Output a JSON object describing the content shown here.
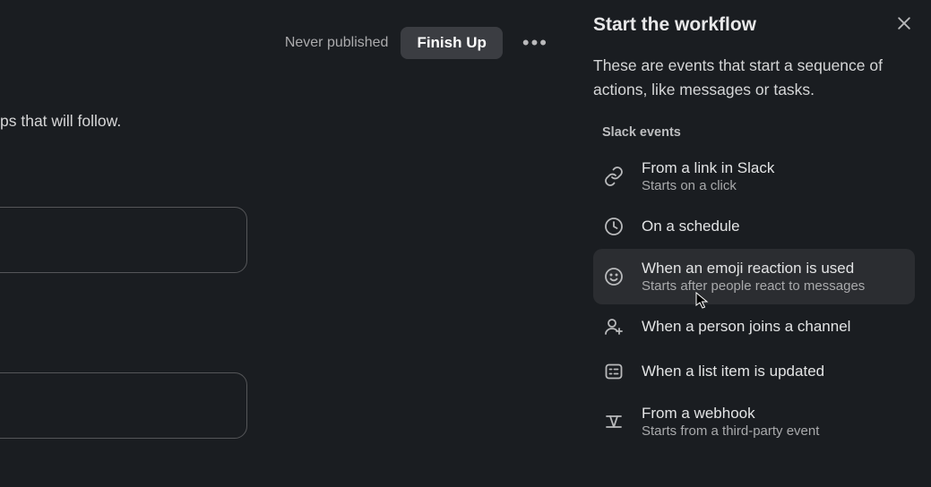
{
  "main": {
    "status": "Never published",
    "finish_label": "Finish Up",
    "body_fragment": "ps that will follow."
  },
  "panel": {
    "title": "Start the workflow",
    "description": "These are events that start a sequence of actions, like messages or tasks.",
    "section_label": "Slack events",
    "events": [
      {
        "icon": "link-icon",
        "title": "From a link in Slack",
        "subtitle": "Starts on a click"
      },
      {
        "icon": "clock-icon",
        "title": "On a schedule",
        "subtitle": ""
      },
      {
        "icon": "emoji-icon",
        "title": "When an emoji reaction is used",
        "subtitle": "Starts after people react to messages"
      },
      {
        "icon": "person-add-icon",
        "title": "When a person joins a channel",
        "subtitle": ""
      },
      {
        "icon": "list-item-icon",
        "title": "When a list item is updated",
        "subtitle": ""
      },
      {
        "icon": "webhook-icon",
        "title": "From a webhook",
        "subtitle": "Starts from a third-party event"
      }
    ],
    "hovered_index": 2
  }
}
